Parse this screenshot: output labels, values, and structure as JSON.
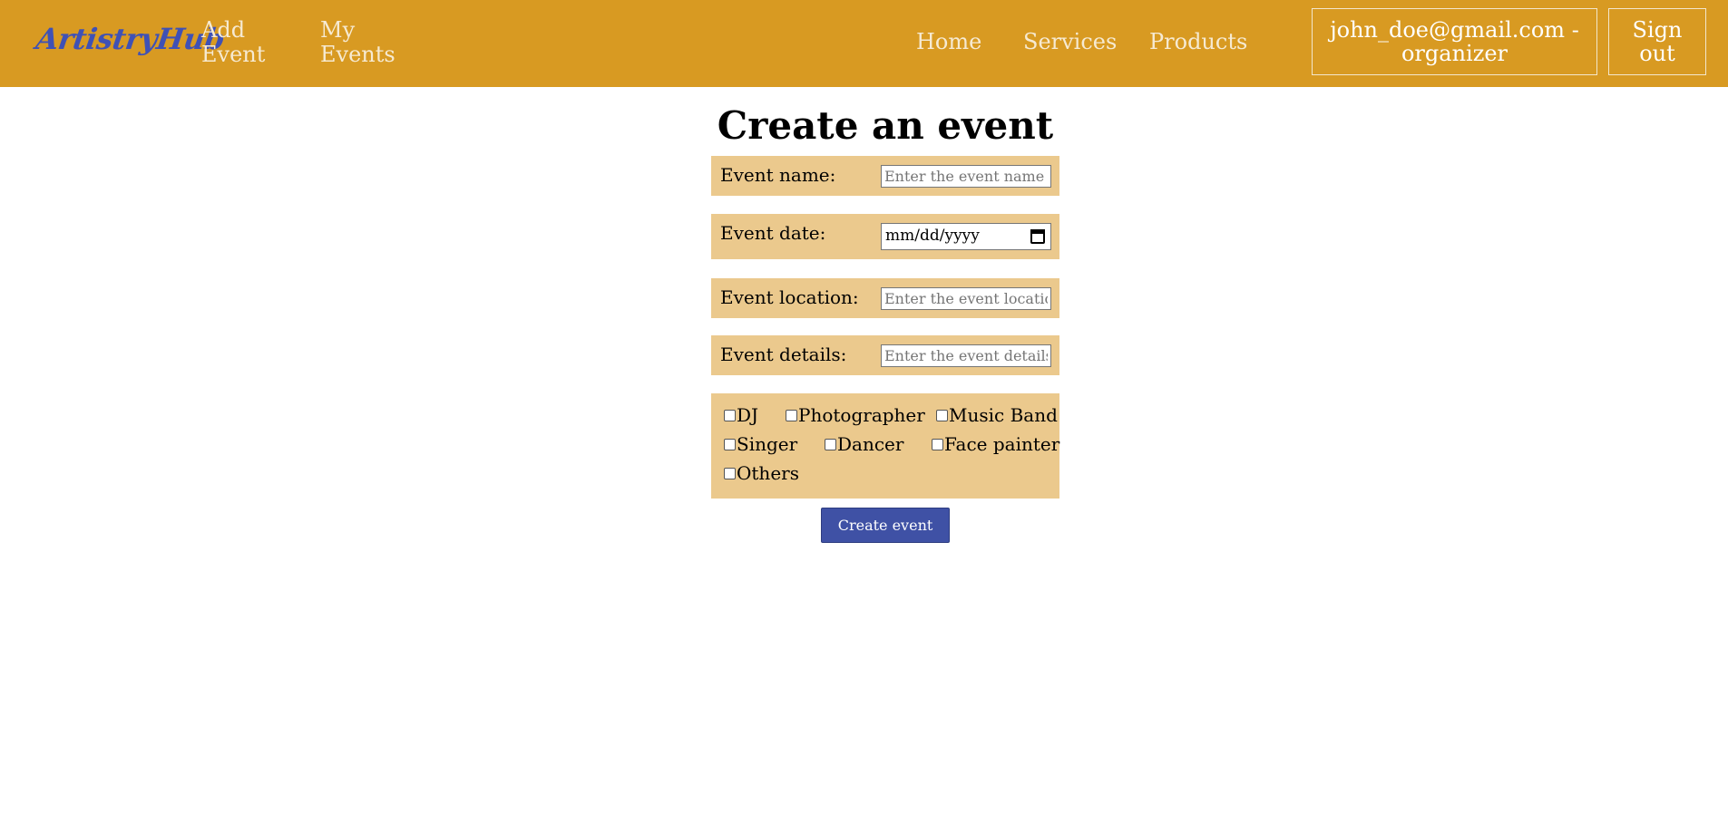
{
  "navbar": {
    "logo": "ArtistryHub",
    "add_event_line1": "Add",
    "add_event_line2": "Event",
    "my_events_line1": "My",
    "my_events_line2": "Events",
    "home": "Home",
    "services": "Services",
    "products": "Products",
    "user_line1": "john_doe@gmail.com -",
    "user_line2": "organizer",
    "signout_line1": "Sign",
    "signout_line2": "out",
    "bg_color": "#d89a22"
  },
  "form": {
    "title": "Create an event",
    "name_label": "Event name:",
    "name_placeholder": "Enter the event name",
    "date_label": "Event date:",
    "date_value": "mm/dd/yyyy",
    "location_label": "Event location:",
    "location_placeholder": "Enter the event location",
    "details_label": "Event details:",
    "details_placeholder": "Enter the event details",
    "row_color": "#ebc98d",
    "checkboxes": {
      "dj": "DJ",
      "photographer": "Photographer",
      "music_band": "Music Band",
      "singer": "Singer",
      "dancer": "Dancer",
      "face_painter": "Face painter",
      "others": "Others"
    },
    "submit_label": "Create event",
    "submit_color": "#3f51a5"
  }
}
